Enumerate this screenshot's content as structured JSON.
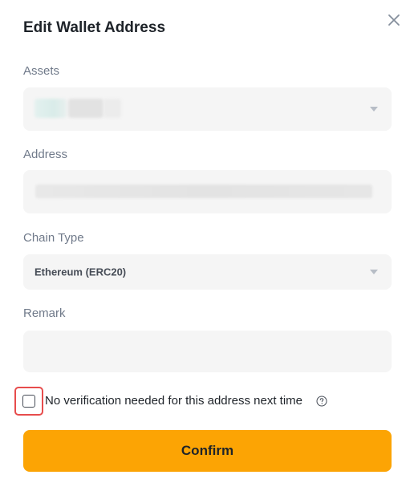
{
  "modal": {
    "title": "Edit Wallet Address"
  },
  "assets": {
    "label": "Assets",
    "value": ""
  },
  "address": {
    "label": "Address",
    "value": ""
  },
  "chain": {
    "label": "Chain Type",
    "value": "Ethereum (ERC20)"
  },
  "remark": {
    "label": "Remark",
    "value": "",
    "placeholder": ""
  },
  "verification": {
    "label": "No verification needed for this address next time",
    "checked": false,
    "help_icon": "question-circle-icon"
  },
  "confirm": {
    "label": "Confirm"
  },
  "colors": {
    "accent": "#fca404",
    "highlight_border": "#e74c4c",
    "field_bg": "#f5f5f5"
  }
}
